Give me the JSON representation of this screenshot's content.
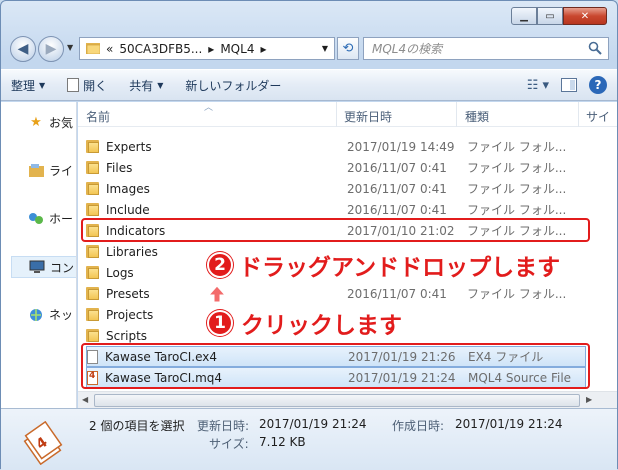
{
  "window": {
    "caption_buttons": [
      "minimize",
      "maximize",
      "close"
    ]
  },
  "address": {
    "prefix": "«",
    "segment1": "50CA3DFB5...",
    "separator1": "▸",
    "segment2": "MQL4",
    "separator2": "▸"
  },
  "search": {
    "placeholder": "MQL4の検索"
  },
  "toolbar": {
    "organize": "整理",
    "open": "開く",
    "share": "共有",
    "new_folder": "新しいフォルダー"
  },
  "nav": {
    "items": [
      {
        "label": "お気",
        "icon": "star-icon"
      },
      {
        "label": "ライ",
        "icon": "library-icon"
      },
      {
        "label": "ホー",
        "icon": "homegroup-icon"
      },
      {
        "label": "コン",
        "icon": "computer-icon"
      },
      {
        "label": "ネッ",
        "icon": "network-icon"
      }
    ]
  },
  "columns": {
    "name": "名前",
    "date": "更新日時",
    "type": "種類",
    "size": "サイ"
  },
  "files": [
    {
      "name": "Experts",
      "date": "2017/01/19 14:49",
      "type": "ファイル フォル...",
      "kind": "folder"
    },
    {
      "name": "Files",
      "date": "2016/11/07 0:41",
      "type": "ファイル フォル...",
      "kind": "folder"
    },
    {
      "name": "Images",
      "date": "2016/11/07 0:41",
      "type": "ファイル フォル...",
      "kind": "folder"
    },
    {
      "name": "Include",
      "date": "2016/11/07 0:41",
      "type": "ファイル フォル...",
      "kind": "folder"
    },
    {
      "name": "Indicators",
      "date": "2017/01/10 21:02",
      "type": "ファイル フォル...",
      "kind": "folder"
    },
    {
      "name": "Libraries",
      "date": "",
      "type": "",
      "kind": "folder"
    },
    {
      "name": "Logs",
      "date": "",
      "type": "",
      "kind": "folder"
    },
    {
      "name": "Presets",
      "date": "2016/11/07 0:41",
      "type": "ファイル フォル...",
      "kind": "folder"
    },
    {
      "name": "Projects",
      "date": "",
      "type": "",
      "kind": "folder"
    },
    {
      "name": "Scripts",
      "date": "",
      "type": "",
      "kind": "folder"
    },
    {
      "name": "Kawase TaroCI.ex4",
      "date": "2017/01/19 21:26",
      "type": "EX4 ファイル",
      "kind": "ex4"
    },
    {
      "name": "Kawase TaroCI.mq4",
      "date": "2017/01/19 21:24",
      "type": "MQL4 Source File",
      "kind": "mq4"
    }
  ],
  "details": {
    "selection": "2 個の項目を選択",
    "modified_label": "更新日時:",
    "modified_value": "2017/01/19 21:24",
    "created_label": "作成日時:",
    "created_value": "2017/01/19 21:24",
    "size_label": "サイズ:",
    "size_value": "7.12 KB"
  },
  "annotations": {
    "step1_number": "1",
    "step1_text": "クリックします",
    "step2_number": "2",
    "step2_text": "ドラッグアンドドロップします",
    "color": "#e21c1c"
  }
}
